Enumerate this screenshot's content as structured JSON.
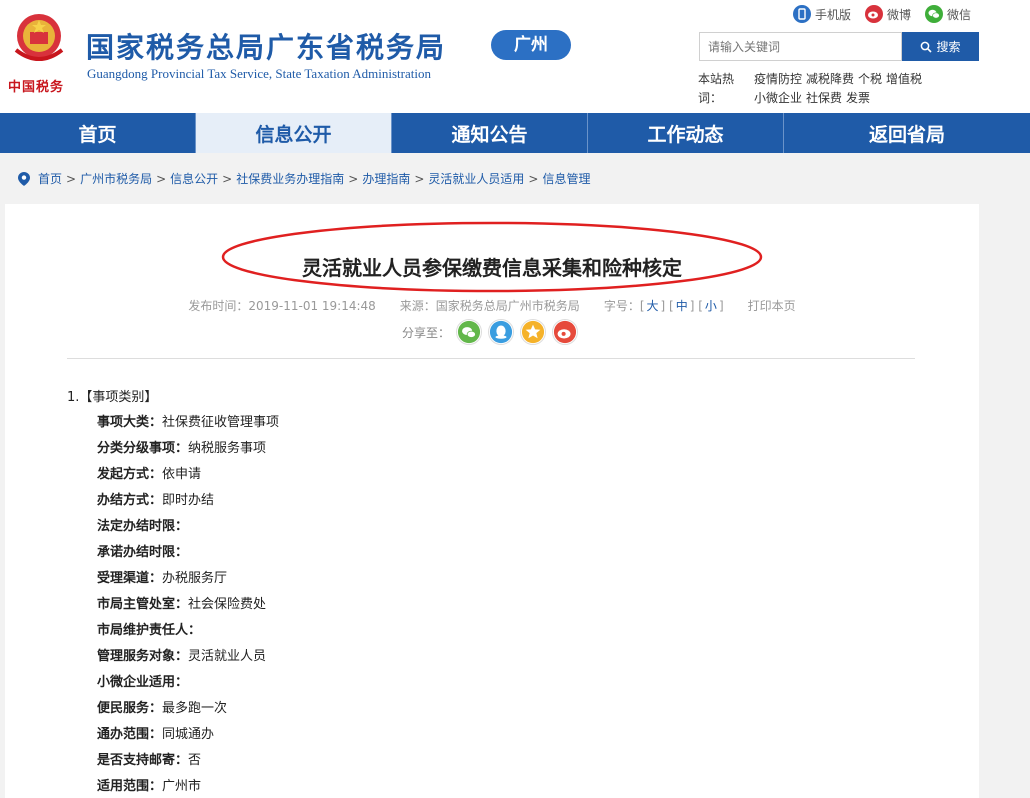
{
  "header": {
    "title": "国家税务总局广东省税务局",
    "subtitle": "Guangdong Provincial Tax Service, State Taxation Administration",
    "emblem_text": "中国税务",
    "city_badge": "广州",
    "top_links": [
      {
        "label": "手机版",
        "icon": "mobile-icon",
        "color": "#2c70c4"
      },
      {
        "label": "微博",
        "icon": "weibo-icon",
        "color": "#d8323c"
      },
      {
        "label": "微信",
        "icon": "wechat-icon",
        "color": "#3fae3a"
      }
    ],
    "search": {
      "placeholder": "请输入关键词",
      "button_label": "搜索"
    },
    "hot_label": "本站热词：",
    "hot_words": [
      "疫情防控",
      "减税降费",
      "个税",
      "增值税",
      "小微企业",
      "社保费",
      "发票"
    ]
  },
  "nav": {
    "items": [
      {
        "label": "首页",
        "active": false
      },
      {
        "label": "信息公开",
        "active": true
      },
      {
        "label": "通知公告",
        "active": false
      },
      {
        "label": "工作动态",
        "active": false
      },
      {
        "label": "返回省局",
        "active": false
      }
    ]
  },
  "breadcrumb": [
    "首页",
    "广州市税务局",
    "信息公开",
    "社保费业务办理指南",
    "办理指南",
    "灵活就业人员适用",
    "信息管理"
  ],
  "article": {
    "title": "灵活就业人员参保缴费信息采集和险种核定",
    "publish_time": "发布时间：2019-11-01 19:14:48",
    "source": "来源：国家税务总局广州市税务局",
    "font_size_label": "字号：",
    "font_sizes": [
      "大",
      "中",
      "小"
    ],
    "print_label": "打印本页",
    "share_label": "分享至：",
    "section_head": "1.【事项类别】",
    "fields": [
      {
        "label": "事项大类：",
        "value": "社保费征收管理事项"
      },
      {
        "label": "分类分级事项：",
        "value": "纳税服务事项"
      },
      {
        "label": "发起方式：",
        "value": "依申请"
      },
      {
        "label": "办结方式：",
        "value": "即时办结"
      },
      {
        "label": "法定办结时限：",
        "value": ""
      },
      {
        "label": "承诺办结时限：",
        "value": ""
      },
      {
        "label": "受理渠道：",
        "value": "办税服务厅"
      },
      {
        "label": "市局主管处室：",
        "value": "社会保险费处"
      },
      {
        "label": "市局维护责任人：",
        "value": ""
      },
      {
        "label": "管理服务对象：",
        "value": "灵活就业人员"
      },
      {
        "label": "小微企业适用：",
        "value": ""
      },
      {
        "label": "便民服务：",
        "value": "最多跑一次"
      },
      {
        "label": "通办范围：",
        "value": "同城通办"
      },
      {
        "label": "是否支持邮寄：",
        "value": "否"
      },
      {
        "label": "适用范围：",
        "value": "广州市"
      }
    ]
  },
  "colors": {
    "brand": "#1f5ba8",
    "oval": "#e02020"
  }
}
